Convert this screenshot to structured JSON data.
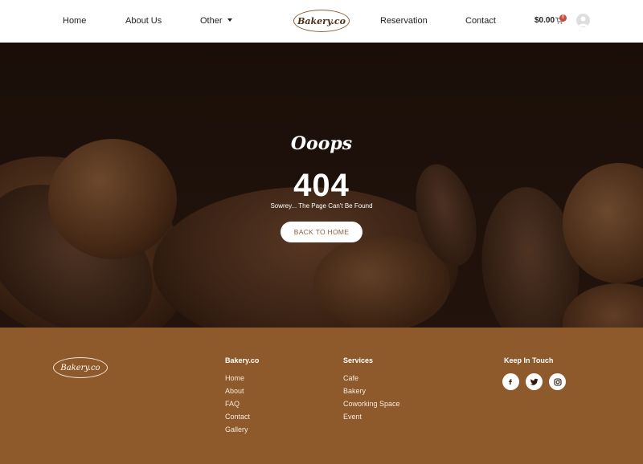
{
  "nav": {
    "home": "Home",
    "about": "About Us",
    "other": "Other",
    "reservation": "Reservation",
    "contact": "Contact",
    "logo": "Bakery.co",
    "cart_amount": "$0.00",
    "cart_count": "0"
  },
  "hero": {
    "ooops": "Ooops",
    "code": "404",
    "message": "Sowrey... The Page Can't Be Found",
    "button": "BACK TO HOME"
  },
  "footer": {
    "logo": "Bakery.co",
    "col1": {
      "heading": "Bakery.co",
      "links": [
        "Home",
        "About",
        "FAQ",
        "Contact",
        "Gallery"
      ]
    },
    "col2": {
      "heading": "Services",
      "links": [
        "Cafe",
        "Bakery",
        "Coworking Space",
        "Event"
      ]
    },
    "col3": {
      "heading": "Keep In Touch",
      "icons": [
        "facebook-icon",
        "twitter-icon",
        "instagram-icon"
      ]
    }
  },
  "colors": {
    "brand_brown": "#8e5a2b",
    "accent_red": "#c94a3a"
  }
}
